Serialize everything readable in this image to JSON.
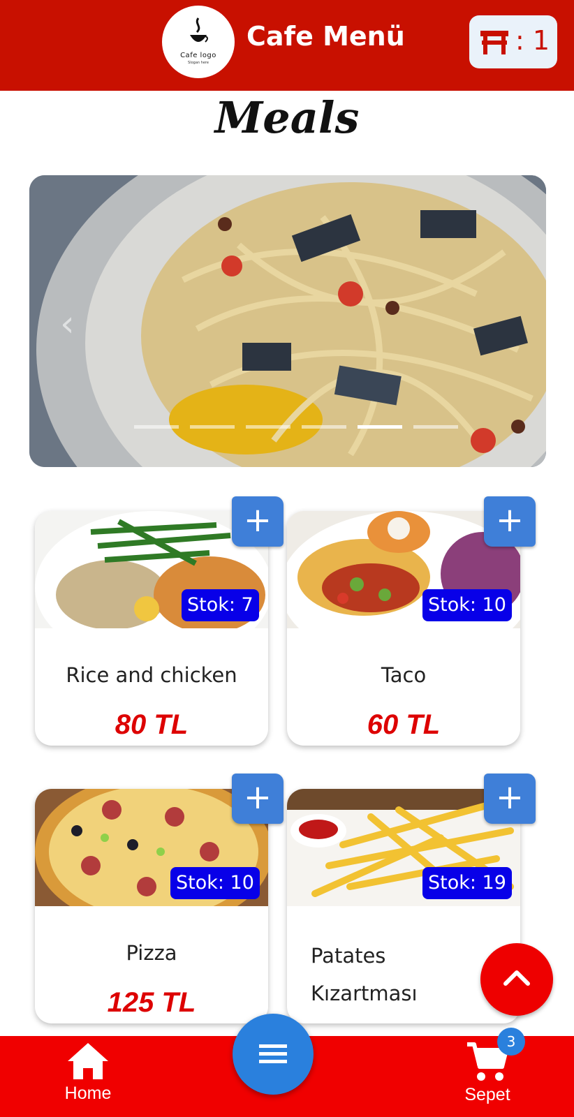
{
  "header": {
    "title": "Cafe Menü",
    "logo_text": "Cafe logo",
    "logo_subtext": "Slogan here",
    "table_label": ": 1",
    "brand_color": "#c81000"
  },
  "section": {
    "title": "Meals"
  },
  "carousel": {
    "prev_icon": "chevron-left-icon",
    "slide_count": 6,
    "active_slide": 4
  },
  "products": [
    {
      "name": "Rice and chicken",
      "price": "80 TL",
      "stock": "Stok: 7",
      "add": "+"
    },
    {
      "name": "Taco",
      "price": "60 TL",
      "stock": "Stok: 10",
      "add": "+"
    },
    {
      "name": "Pizza",
      "price": "125 TL",
      "stock": "Stok: 10",
      "add": "+"
    },
    {
      "name": "Patates Kızartması",
      "name_line1": "Patates",
      "name_line2": "Kızartması",
      "price": "",
      "stock": "Stok: 19",
      "add": "+"
    }
  ],
  "bottom_nav": {
    "home_label": "Home",
    "cart_label": "Sepet",
    "cart_count": "3",
    "menu_icon": "menu-icon"
  },
  "colors": {
    "header": "#c81000",
    "bottom_bar": "#f00000",
    "stock_badge": "#0800e8",
    "add_button": "#3f7fd8",
    "price": "#dd0000",
    "fab": "#2a80dd"
  }
}
